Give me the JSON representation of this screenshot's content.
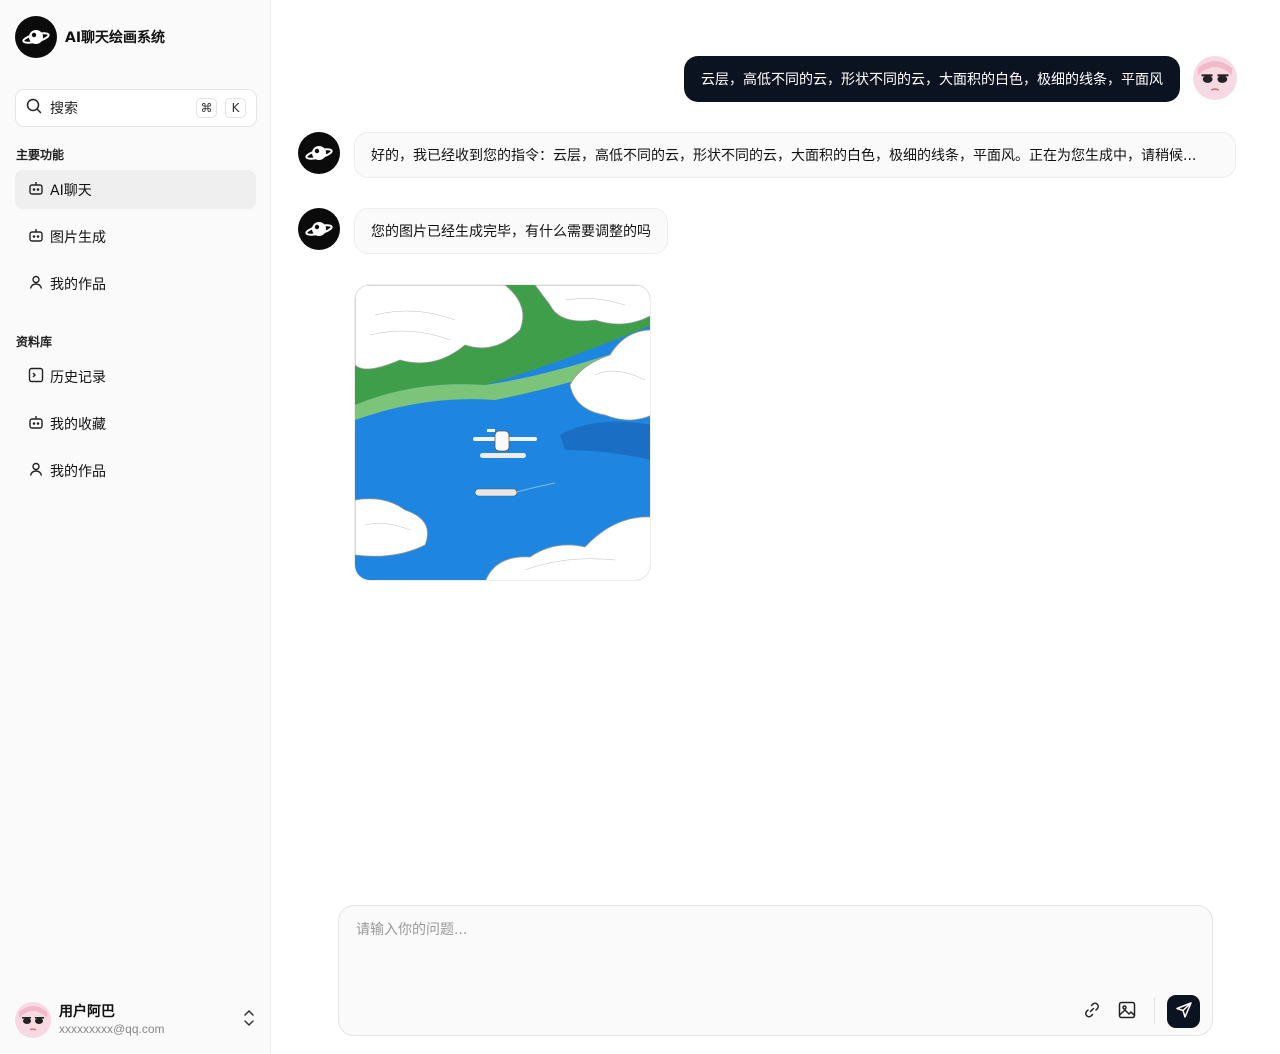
{
  "app": {
    "title": "AI聊天绘画系统"
  },
  "search": {
    "placeholder": "搜索",
    "shortcut_mod": "⌘",
    "shortcut_key": "K"
  },
  "sections": {
    "main": {
      "title": "主要功能",
      "items": [
        {
          "label": "AI聊天",
          "icon": "bot-icon",
          "active": true
        },
        {
          "label": "图片生成",
          "icon": "bot-icon",
          "active": false
        },
        {
          "label": "我的作品",
          "icon": "user-icon",
          "active": false
        }
      ]
    },
    "library": {
      "title": "资料库",
      "items": [
        {
          "label": "历史记录",
          "icon": "terminal-icon"
        },
        {
          "label": "我的收藏",
          "icon": "bot-icon"
        },
        {
          "label": "我的作品",
          "icon": "user-icon"
        }
      ]
    }
  },
  "user": {
    "name": "用户阿巴",
    "email": "xxxxxxxxx@qq.com"
  },
  "chat": {
    "messages": [
      {
        "role": "user",
        "text": "云层，高低不同的云，形状不同的云，大面积的白色，极细的线条，平面风"
      },
      {
        "role": "assistant",
        "text": "好的，我已经收到您的指令：云层，高低不同的云，形状不同的云，大面积的白色，极细的线条，平面风。正在为您生成中，请稍候..."
      },
      {
        "role": "assistant",
        "text": "您的图片已经生成完毕，有什么需要调整的吗"
      }
    ]
  },
  "composer": {
    "placeholder": "请输入你的问题..."
  },
  "colors": {
    "accent": "#0b1220",
    "sidebar_bg": "#fafafa",
    "active_item": "#efefef"
  }
}
